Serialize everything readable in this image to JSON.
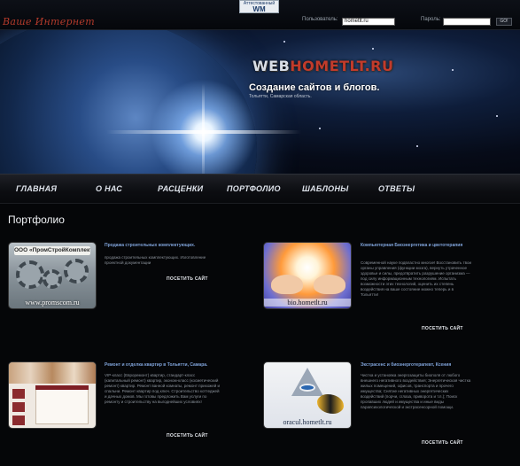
{
  "header": {
    "badge_line1": "Аттестованный",
    "badge_line2": "WM",
    "logo_small": "Ваше Интернет",
    "user_label": "Пользователь:",
    "user_value": "hometlt.ru",
    "password_label": "Пароль:",
    "login_button": "GO!"
  },
  "hero": {
    "brand_prefix": "WEB",
    "brand_main": "HOMETLT.RU",
    "title": "Создание сайтов и блогов.",
    "subtitle": "Тольятти, Самарская область."
  },
  "nav": {
    "items": [
      {
        "label": "ГЛАВНАЯ"
      },
      {
        "label": "О НАС"
      },
      {
        "label": "РАСЦЕНКИ"
      },
      {
        "label": "ПОРТФОЛИО"
      },
      {
        "label": "ШАБЛОНЫ"
      },
      {
        "label": "ОТВЕТЫ"
      }
    ]
  },
  "main": {
    "page_title": "Портфолио",
    "cards": [
      {
        "title": "Продажа строительных комплектующих.",
        "text": "продажа строительных комплектующих. Изготовление проектной документации",
        "image_plate": "ООО «ПромСтройКомплект»",
        "image_url": "www.promscom.ru",
        "link": "ПОСЕТИТЬ САЙТ"
      },
      {
        "title": "Компьютерная Биоэнергетика и цветотерапия",
        "text": "Современной науке подвластно многое! Восстановить твои органы управления (функции мозга), вернуть утраченное здоровье и силы, предотвратить разрушение организма — под силу информационным технологиям. Испытать возможности этих технологий, оценить их степень воздействия на ваше состояние можно теперь и в Тольятти!",
        "image_url": "bio.hometlt.ru",
        "link": "ПОСЕТИТЬ САЙТ"
      },
      {
        "title": "Ремонт и отделка квартир в Тольятти, Самара.",
        "text": "VIP-класс (Евроремонт) квартир, стандарт-класс (капитальный ремонт) квартир, эконом-класс (косметический ремонт) квартир. Ремонт ванной комнаты, ремонт прихожей и спальни. Ремонт квартир под ключ. Строительство коттеджей и дачных домов. Мы готовы предложить Вам услуги по ремонту и строительству на выгоднейших условиях!",
        "link": "ПОСЕТИТЬ САЙТ"
      },
      {
        "title": "Экстрасенс и биоэнерготерапевт, Ксения",
        "text": "Чистка и установка энергозащиты биополя от любого внешнего негативного воздействия; Энергетическая чистка жилых помещений, офисов, транспорта и прочего имущества; Снятие негативных энергетических воздействий (порчи, сглаза, приворота и т.п.); Поиск пропавших людей и имущества и иные виды парапсихологической и экстрасенсорной помощи.",
        "image_url": "oracul.hometlt.ru",
        "link": "ПОСЕТИТЬ САЙТ"
      }
    ]
  }
}
